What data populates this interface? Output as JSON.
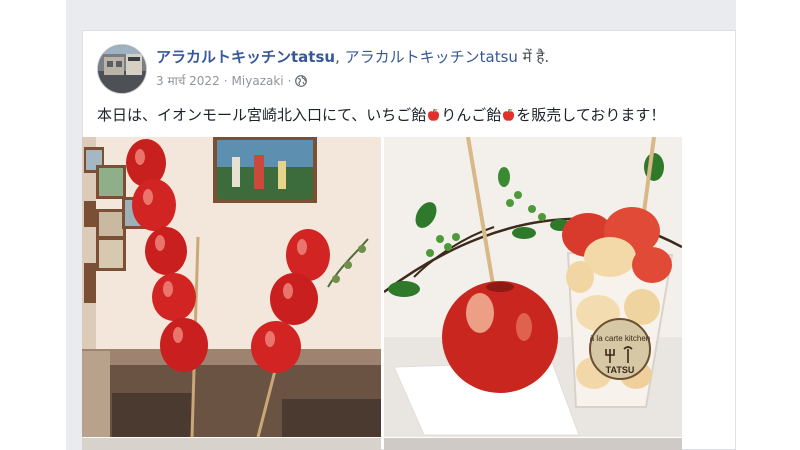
{
  "post": {
    "author_name": "アラカルトキッチンtatsu",
    "author_line_rest_prefix": ", ",
    "author_link": "アラカルトキッチンtatsu",
    "author_line_suffix": " में है.",
    "date": "3 मार्च 2022",
    "separator": "·",
    "location": "Miyazaki",
    "text_part1": "本日は、イオンモール宮崎北入口にて、いちご飴",
    "text_part2": "りんご飴",
    "text_part3": "を販売しております！"
  },
  "photos": {
    "photo2_sticker_line1": "à la carte kitchen",
    "photo2_sticker_line2": "TATSU"
  },
  "icons": {
    "privacy": "globe-icon",
    "fruit": "apple-emoji-icon"
  },
  "colors": {
    "link": "#365899",
    "meta": "#90949c",
    "text": "#1d2129",
    "feed_bg": "#e9ebee"
  }
}
